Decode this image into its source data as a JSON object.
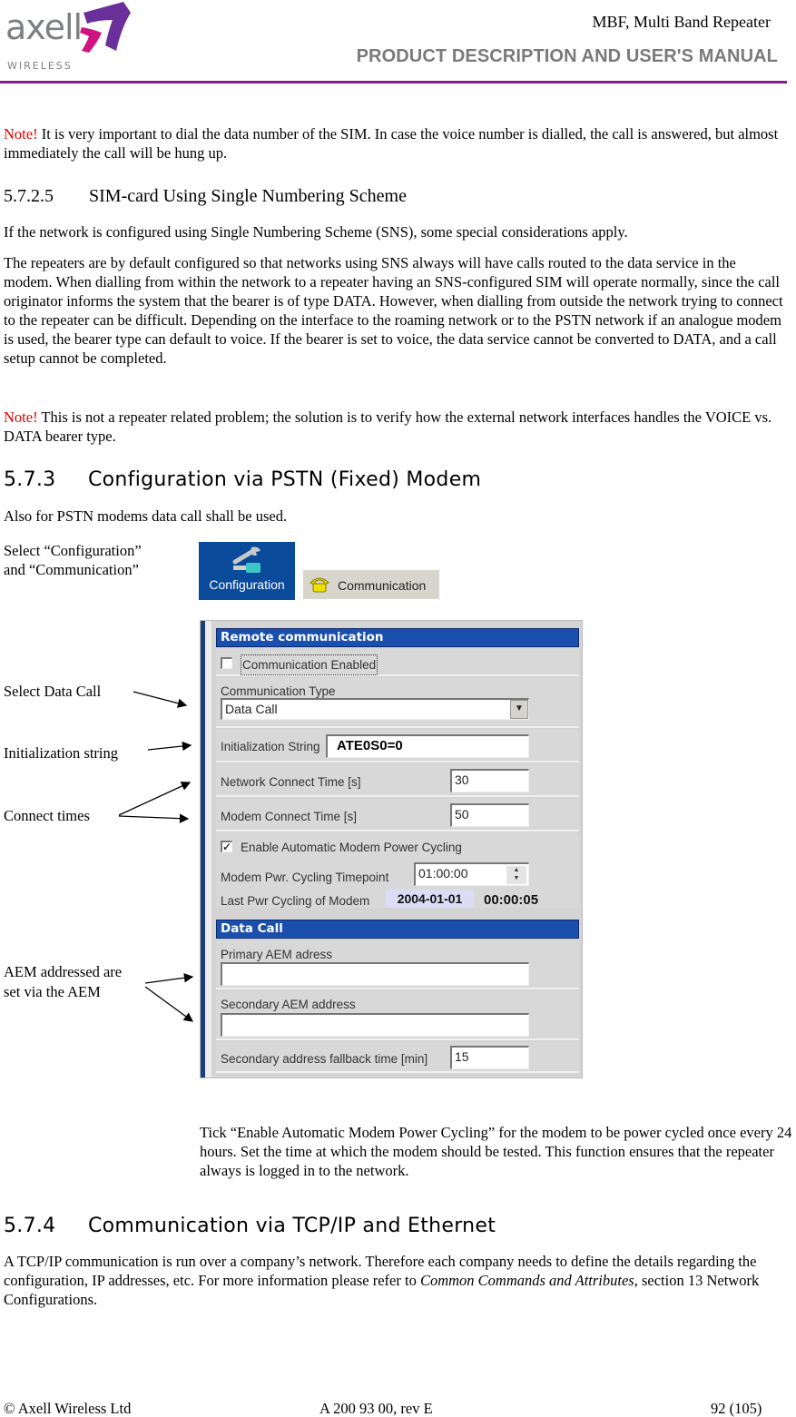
{
  "header": {
    "logo": {
      "wordmark": "axell",
      "subline": "WIRELESS",
      "colors": {
        "wordmark": "#7c7f84",
        "chevron_magenta": "#d0137e",
        "chevron_purple": "#6b2f9a"
      }
    },
    "title": "MBF, Multi Band Repeater",
    "subtitle": "PRODUCT DESCRIPTION AND USER'S MANUAL",
    "rule_color": "#8b1a8b"
  },
  "note1": {
    "keyword": "Note!",
    "text": " It is very important to dial the data number of the SIM. In case the voice number is dialled, the call is answered, but almost immediately the call will be hung up."
  },
  "section_5725": {
    "number": "5.7.2.5",
    "title": "SIM-card Using Single Numbering Scheme",
    "para1": "If the network is configured using Single Numbering Scheme (SNS), some special considerations apply.",
    "para2": "The repeaters are by default configured so that networks using SNS always will have calls routed to the data service in the modem. When dialling from within the network to a repeater having an SNS-configured SIM will operate normally, since the call originator informs the system that the bearer is of type DATA. However, when dialling from outside the network trying to connect to the repeater can be difficult. Depending on the interface to the roaming network or to the PSTN network if an analogue modem is used, the bearer type can default to voice. If the bearer is set to voice, the data service cannot be converted to DATA, and a call setup cannot be completed.",
    "note_keyword": "Note!",
    "note_text": " This is not a repeater related problem; the solution is to verify how the external network interfaces handles the VOICE vs. DATA bearer type."
  },
  "section_573": {
    "number": "5.7.3",
    "title": "Configuration via PSTN (Fixed) Modem",
    "intro": "Also for PSTN modems data call shall be used.",
    "select_instruction": "Select “Configuration” and “Communication”",
    "toolbar": {
      "configuration_label": "Configuration",
      "communication_label": "Communication"
    },
    "annotations": {
      "select_data_call": "Select Data Call",
      "init_string": "Initialization string",
      "connect_times": "Connect times",
      "aem_line1": "AEM addressed are",
      "aem_line2": "set via the AEM"
    },
    "panel": {
      "remote_header": "Remote communication",
      "communication_enabled_label": "Communication Enabled",
      "communication_enabled_checked": false,
      "communication_type_label": "Communication Type",
      "communication_type_value": "Data Call",
      "init_string_label": "Initialization String",
      "init_string_value": "ATE0S0=0",
      "network_connect_label": "Network Connect Time [s]",
      "network_connect_value": "30",
      "modem_connect_label": "Modem Connect Time [s]",
      "modem_connect_value": "50",
      "power_cycling_label": "Enable Automatic Modem Power Cycling",
      "power_cycling_checked": true,
      "timepoint_label": "Modem Pwr. Cycling Timepoint",
      "timepoint_value": "01:00:00",
      "last_cycle_label": "Last Pwr Cycling of Modem",
      "last_cycle_date": "2004-01-01",
      "last_cycle_time": "00:00:05",
      "data_call_header": "Data Call",
      "primary_aem_label": "Primary AEM adress",
      "primary_aem_value": "",
      "secondary_aem_label": "Secondary AEM address",
      "secondary_aem_value": "",
      "fallback_label": "Secondary address fallback time [min]",
      "fallback_value": "15",
      "colors": {
        "header_bg": "#1b4fae",
        "panel_bg": "#d4d4d4"
      }
    },
    "tick_text": "Tick “Enable Automatic Modem Power Cycling” for the modem to be power cycled once every 24 hours. Set the time at which the modem should be tested. This function ensures that the repeater always is logged in to the network."
  },
  "section_574": {
    "number": "5.7.4",
    "title": "Communication via TCP/IP and Ethernet",
    "para_before": "A TCP/IP communication is run over a company’s network. Therefore each company needs to define the details regarding the configuration, IP addresses, etc. For more information please refer to ",
    "para_italic": "Common Commands and Attributes",
    "para_after": ", section 13 Network Configurations."
  },
  "footer": {
    "copyright": "© Axell Wireless Ltd",
    "doc_id": "A 200 93 00, rev E",
    "page": "92 (105)"
  }
}
